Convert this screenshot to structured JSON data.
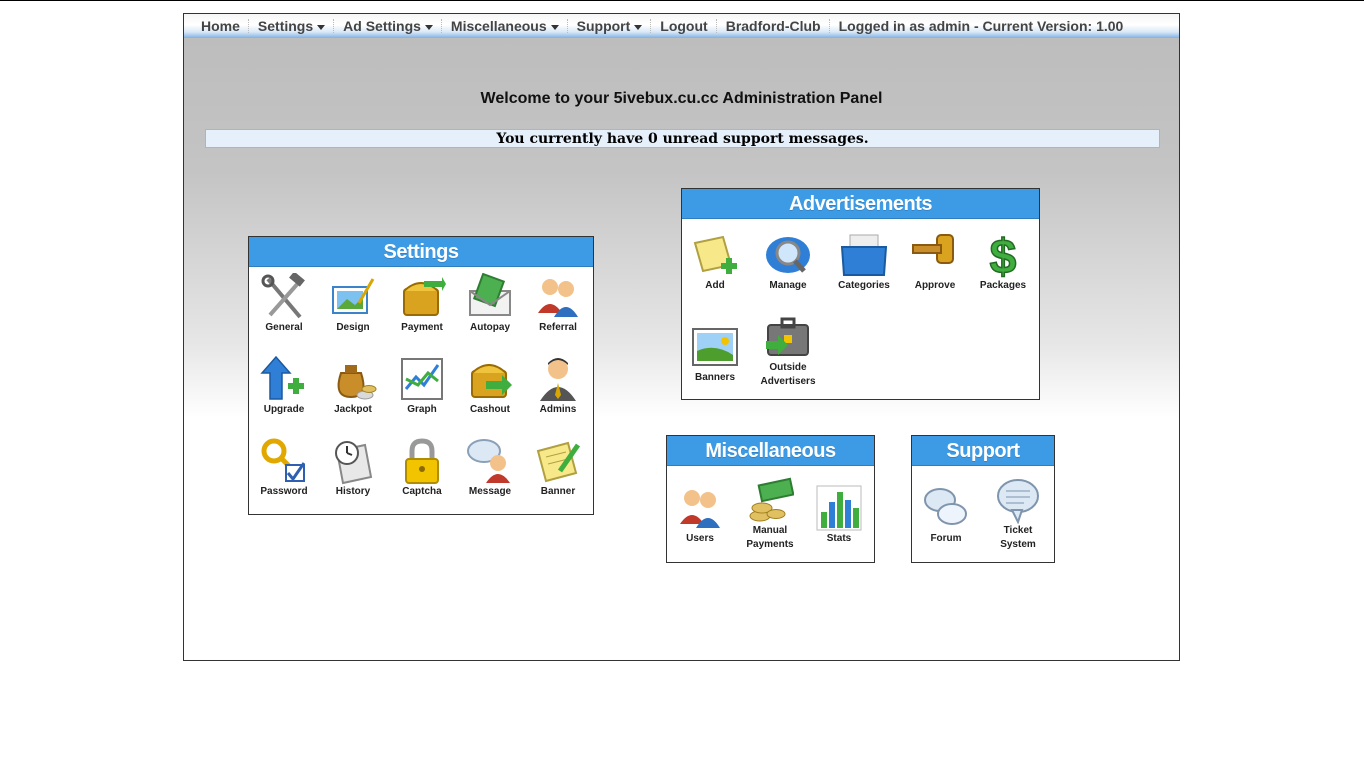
{
  "nav": {
    "home": "Home",
    "settings": "Settings",
    "ad_settings": "Ad Settings",
    "miscellaneous": "Miscellaneous",
    "support": "Support",
    "logout": "Logout",
    "club": "Bradford-Club",
    "status": "Logged in as admin - Current Version: 1.00"
  },
  "welcome": "Welcome to your 5ivebux.cu.cc Administration Panel",
  "notice": "You currently have 0 unread support messages.",
  "panels": {
    "settings": {
      "title": "Settings",
      "items": [
        "General",
        "Design",
        "Payment",
        "Autopay",
        "Referral",
        "Upgrade",
        "Jackpot",
        "Graph",
        "Cashout",
        "Admins",
        "Password",
        "History",
        "Captcha",
        "Message",
        "Banner"
      ]
    },
    "ads": {
      "title": "Advertisements",
      "items": [
        "Add",
        "Manage",
        "Categories",
        "Approve",
        "Packages",
        "Banners",
        "Outside Advertisers"
      ]
    },
    "misc": {
      "title": "Miscellaneous",
      "items": [
        "Users",
        "Manual Payments",
        "Stats"
      ]
    },
    "support": {
      "title": "Support",
      "items": [
        "Forum",
        "Ticket System"
      ]
    }
  },
  "colors": {
    "panel_header": "#3d9be6",
    "notice_bg": "#e6f0fb"
  }
}
